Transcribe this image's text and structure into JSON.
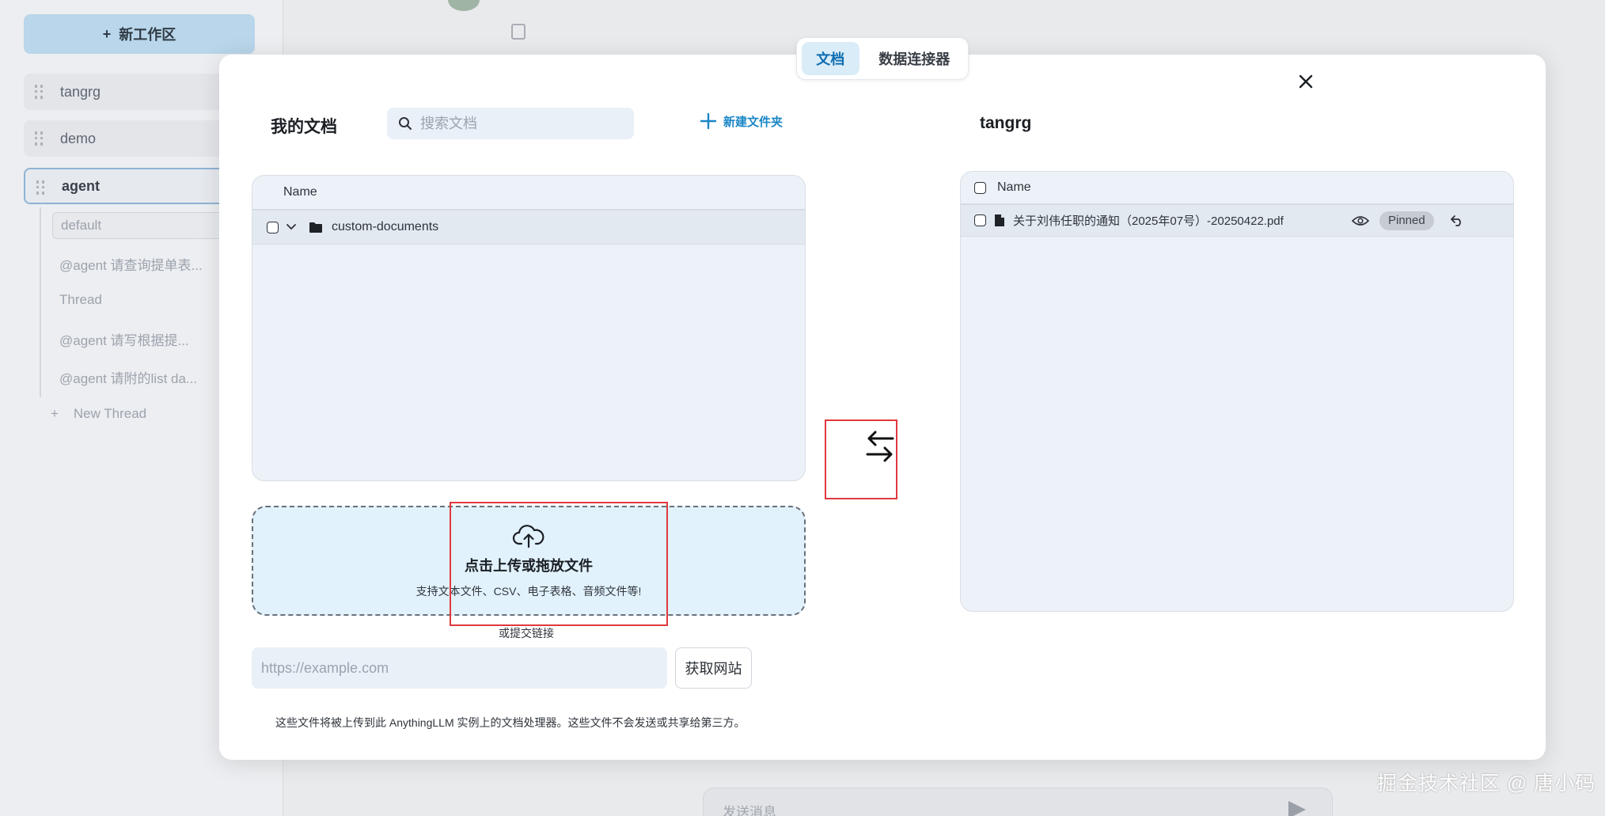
{
  "background": {
    "new_workspace_label": "新工作区",
    "workspaces": [
      "tangrg",
      "demo",
      "agent"
    ],
    "threads": [
      "default",
      "@agent 请查询提单表...",
      "Thread",
      "@agent 请写根据提...",
      "@agent 请附的list da..."
    ],
    "new_thread_label": "New Thread",
    "chat_placeholder": "发送消息",
    "watermark": "掘金技术社区 @ 唐小码"
  },
  "modal": {
    "tabs": [
      {
        "label": "文档",
        "active": true
      },
      {
        "label": "数据连接器",
        "active": false
      }
    ],
    "left": {
      "title": "我的文档",
      "search_placeholder": "搜索文档",
      "new_folder_label": "新建文件夹",
      "column_name": "Name",
      "folders": [
        {
          "name": "custom-documents",
          "expanded": true
        }
      ]
    },
    "upload": {
      "title": "点击上传或拖放文件",
      "subtitle": "支持文本文件、CSV、电子表格、音频文件等!",
      "or_link_label": "或提交链接",
      "url_placeholder": "https://example.com",
      "fetch_button": "获取网站"
    },
    "notice": "这些文件将被上传到此 AnythingLLM 实例上的文档处理器。这些文件不会发送或共享给第三方。",
    "right": {
      "title": "tangrg",
      "column_name": "Name",
      "files": [
        {
          "name": "关于刘伟任职的通知（2025年07号）-20250422.pdf",
          "badge": "Pinned"
        }
      ]
    }
  },
  "colors": {
    "accent": "#1a86c7",
    "tab_active_bg": "#d9ecf8",
    "upload_bg": "#e2f2fd",
    "highlight_red": "#e0393e"
  },
  "icons": [
    "plus-icon",
    "search-icon",
    "chevron-down-icon",
    "folder-icon",
    "file-icon",
    "eye-icon",
    "undo-icon",
    "cloud-upload-icon",
    "swap-arrows-icon",
    "close-icon",
    "send-icon",
    "copy-icon"
  ]
}
